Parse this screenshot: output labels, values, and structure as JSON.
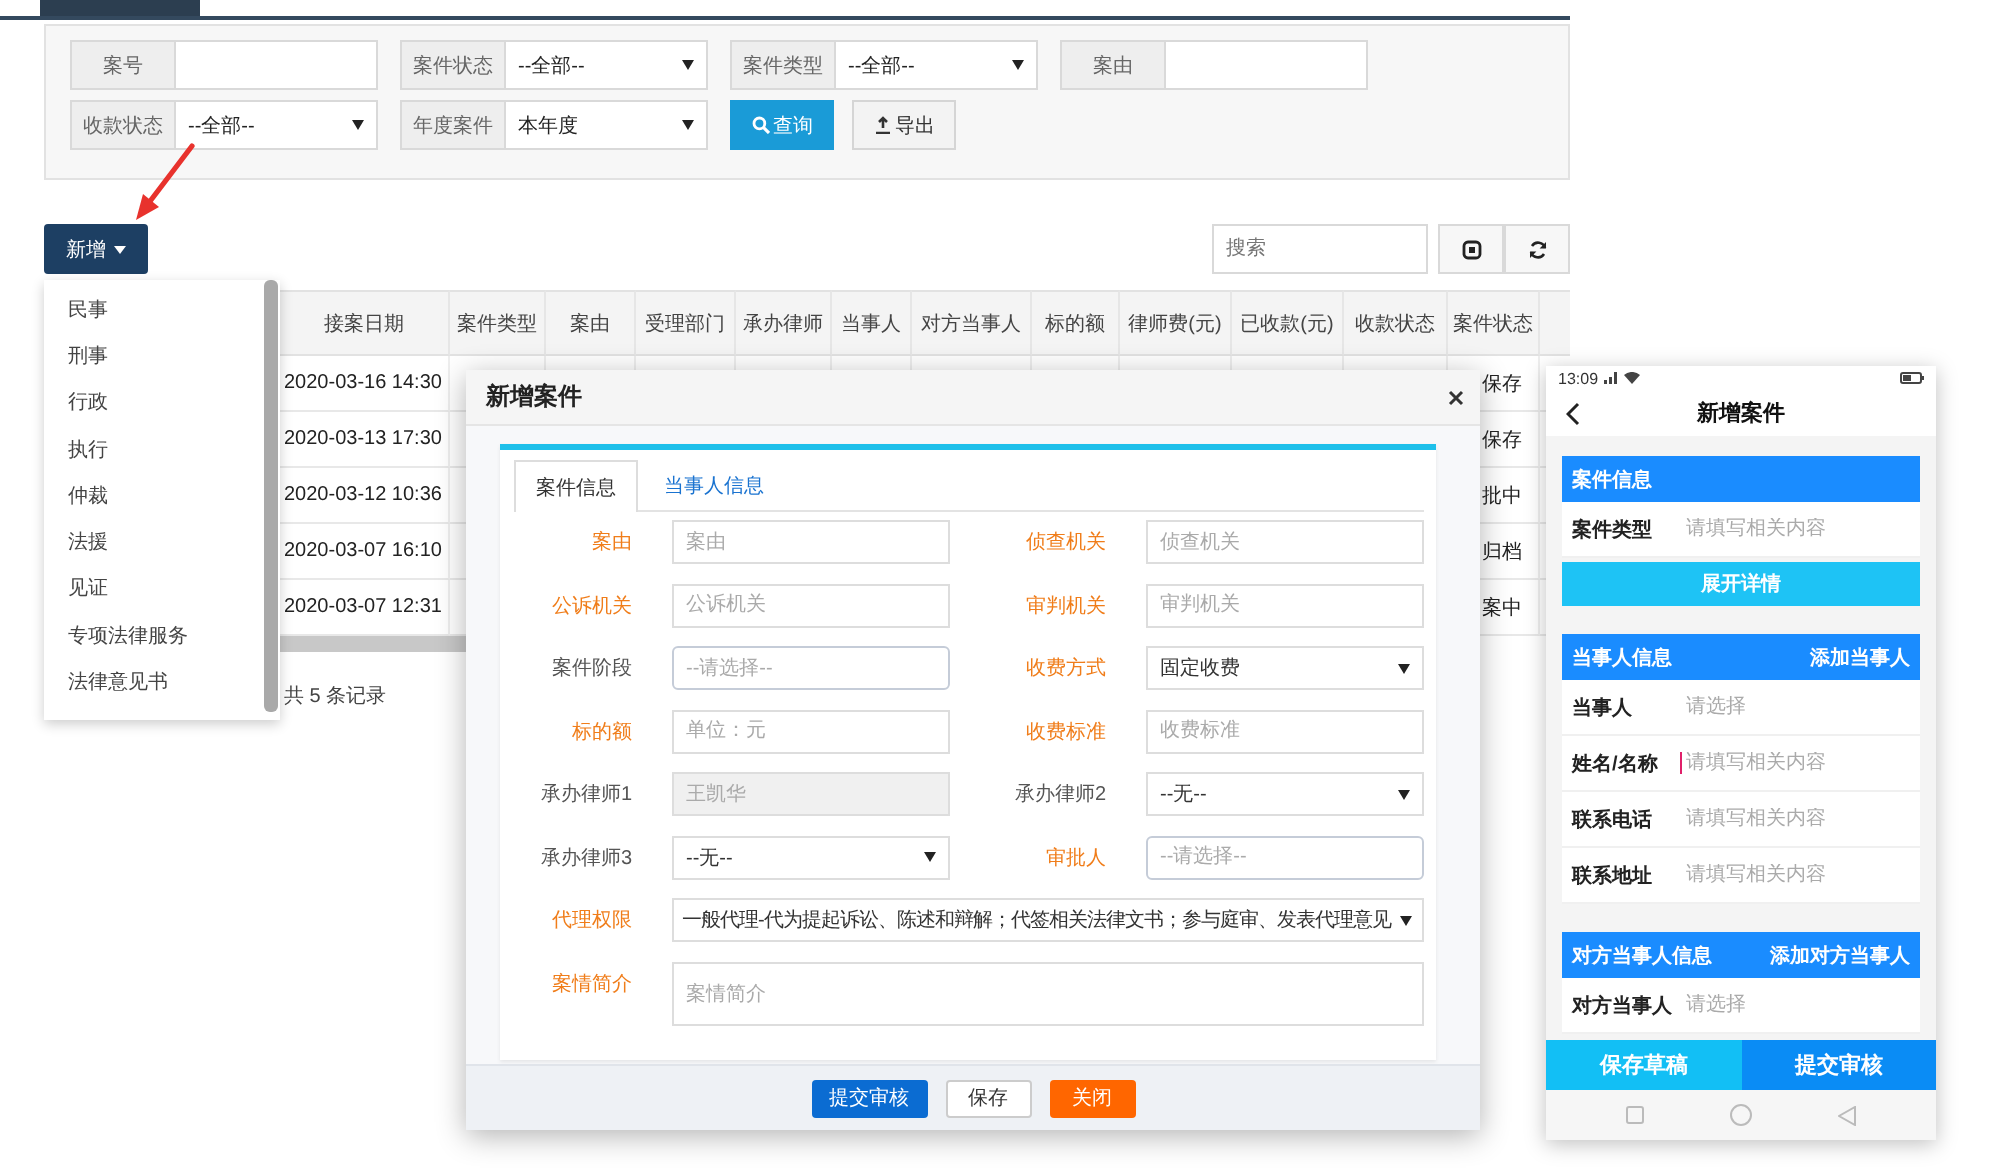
{
  "filters": {
    "rows": [
      [
        {
          "label": "案号",
          "kind": "text"
        },
        {
          "label": "案件状态",
          "kind": "select",
          "value": "--全部--"
        },
        {
          "label": "案件类型",
          "kind": "select",
          "value": "--全部--"
        },
        {
          "label": "案由",
          "kind": "text"
        }
      ],
      [
        {
          "label": "收款状态",
          "kind": "select",
          "value": "--全部--"
        },
        {
          "label": "年度案件",
          "kind": "select",
          "value": "本年度"
        }
      ]
    ],
    "buttons": [
      {
        "label": "查询",
        "kind": "primary"
      },
      {
        "label": "导出",
        "kind": "default"
      }
    ]
  },
  "add_button": {
    "label": "新增"
  },
  "search": {
    "placeholder": "搜索"
  },
  "table": {
    "columns": [
      "接案日期",
      "案件类型",
      "案由",
      "受理部门",
      "承办律师",
      "当事人",
      "对方当事人",
      "标的额",
      "律师费(元)",
      "已收款(元)",
      "收款状态",
      "案件状态"
    ],
    "rows": [
      {
        "date": "2020-03-16 14:30",
        "status": "保存"
      },
      {
        "date": "2020-03-13 17:30",
        "status": "保存"
      },
      {
        "date": "2020-03-12 10:36",
        "status": "批中"
      },
      {
        "date": "2020-03-07 16:10",
        "status": "归档"
      },
      {
        "date": "2020-03-07 12:31",
        "status": "案中"
      }
    ],
    "footer": "共 5 条记录"
  },
  "add_menu": {
    "items": [
      "民事",
      "刑事",
      "行政",
      "执行",
      "仲裁",
      "法援",
      "见证",
      "专项法律服务",
      "法律意见书"
    ]
  },
  "modal": {
    "title": "新增案件",
    "tabs": [
      {
        "label": "案件信息",
        "selected": true
      },
      {
        "label": "当事人信息",
        "selected": false
      }
    ],
    "fields": [
      {
        "label": "案由",
        "required": true,
        "kind": "input",
        "placeholder": "案由",
        "disabled": false
      },
      {
        "label": "侦查机关",
        "required": true,
        "kind": "input",
        "placeholder": "侦查机关",
        "disabled": false
      },
      {
        "label": "公诉机关",
        "required": true,
        "kind": "input",
        "placeholder": "公诉机关",
        "disabled": false
      },
      {
        "label": "审判机关",
        "required": true,
        "kind": "input",
        "placeholder": "审判机关",
        "disabled": false
      },
      {
        "label": "案件阶段",
        "required": false,
        "kind": "picker",
        "placeholder": "--请选择--",
        "disabled": false
      },
      {
        "label": "收费方式",
        "required": true,
        "kind": "select",
        "value": "固定收费",
        "disabled": false
      },
      {
        "label": "标的额",
        "required": true,
        "kind": "input",
        "placeholder": "单位：元",
        "disabled": false
      },
      {
        "label": "收费标准",
        "required": true,
        "kind": "input",
        "placeholder": "收费标准",
        "disabled": false
      },
      {
        "label": "承办律师1",
        "required": false,
        "kind": "input",
        "placeholder": "王凯华",
        "disabled": true
      },
      {
        "label": "承办律师2",
        "required": false,
        "kind": "select",
        "value": "--无--",
        "disabled": false
      },
      {
        "label": "承办律师3",
        "required": false,
        "kind": "select",
        "value": "--无--",
        "disabled": false
      },
      {
        "label": "审批人",
        "required": true,
        "kind": "picker",
        "placeholder": "--请选择--",
        "disabled": false
      },
      {
        "label": "代理权限",
        "required": true,
        "kind": "wide-select",
        "value": "一般代理-代为提起诉讼、陈述和辩解；代签相关法律文书；参与庭审、发表代理意见",
        "disabled": false
      },
      {
        "label": "案情简介",
        "required": true,
        "kind": "textarea",
        "placeholder": "案情简介",
        "disabled": false
      }
    ],
    "buttons": [
      {
        "label": "提交审核",
        "kind": "primary"
      },
      {
        "label": "保存",
        "kind": "default"
      },
      {
        "label": "关闭",
        "kind": "danger"
      }
    ]
  },
  "mobile": {
    "status_time": "13:09",
    "title": "新增案件",
    "sections": [
      {
        "title": "案件信息",
        "rows": [
          {
            "label": "案件类型",
            "placeholder": "请填写相关内容",
            "focused": false
          }
        ],
        "expand_button": "展开详情"
      },
      {
        "title": "当事人信息",
        "action": "添加当事人",
        "rows": [
          {
            "label": "当事人",
            "placeholder": "请选择",
            "focused": false
          },
          {
            "label": "姓名/名称",
            "placeholder": "请填写相关内容",
            "focused": true
          },
          {
            "label": "联系电话",
            "placeholder": "请填写相关内容",
            "focused": false
          },
          {
            "label": "联系地址",
            "placeholder": "请填写相关内容",
            "focused": false
          }
        ]
      },
      {
        "title": "对方当事人信息",
        "action": "添加对方当事人",
        "rows": [
          {
            "label": "对方当事人",
            "placeholder": "请选择",
            "focused": false
          }
        ]
      }
    ],
    "buttons": [
      {
        "label": "保存草稿",
        "kind": "secondary"
      },
      {
        "label": "提交审核",
        "kind": "primary"
      }
    ]
  }
}
